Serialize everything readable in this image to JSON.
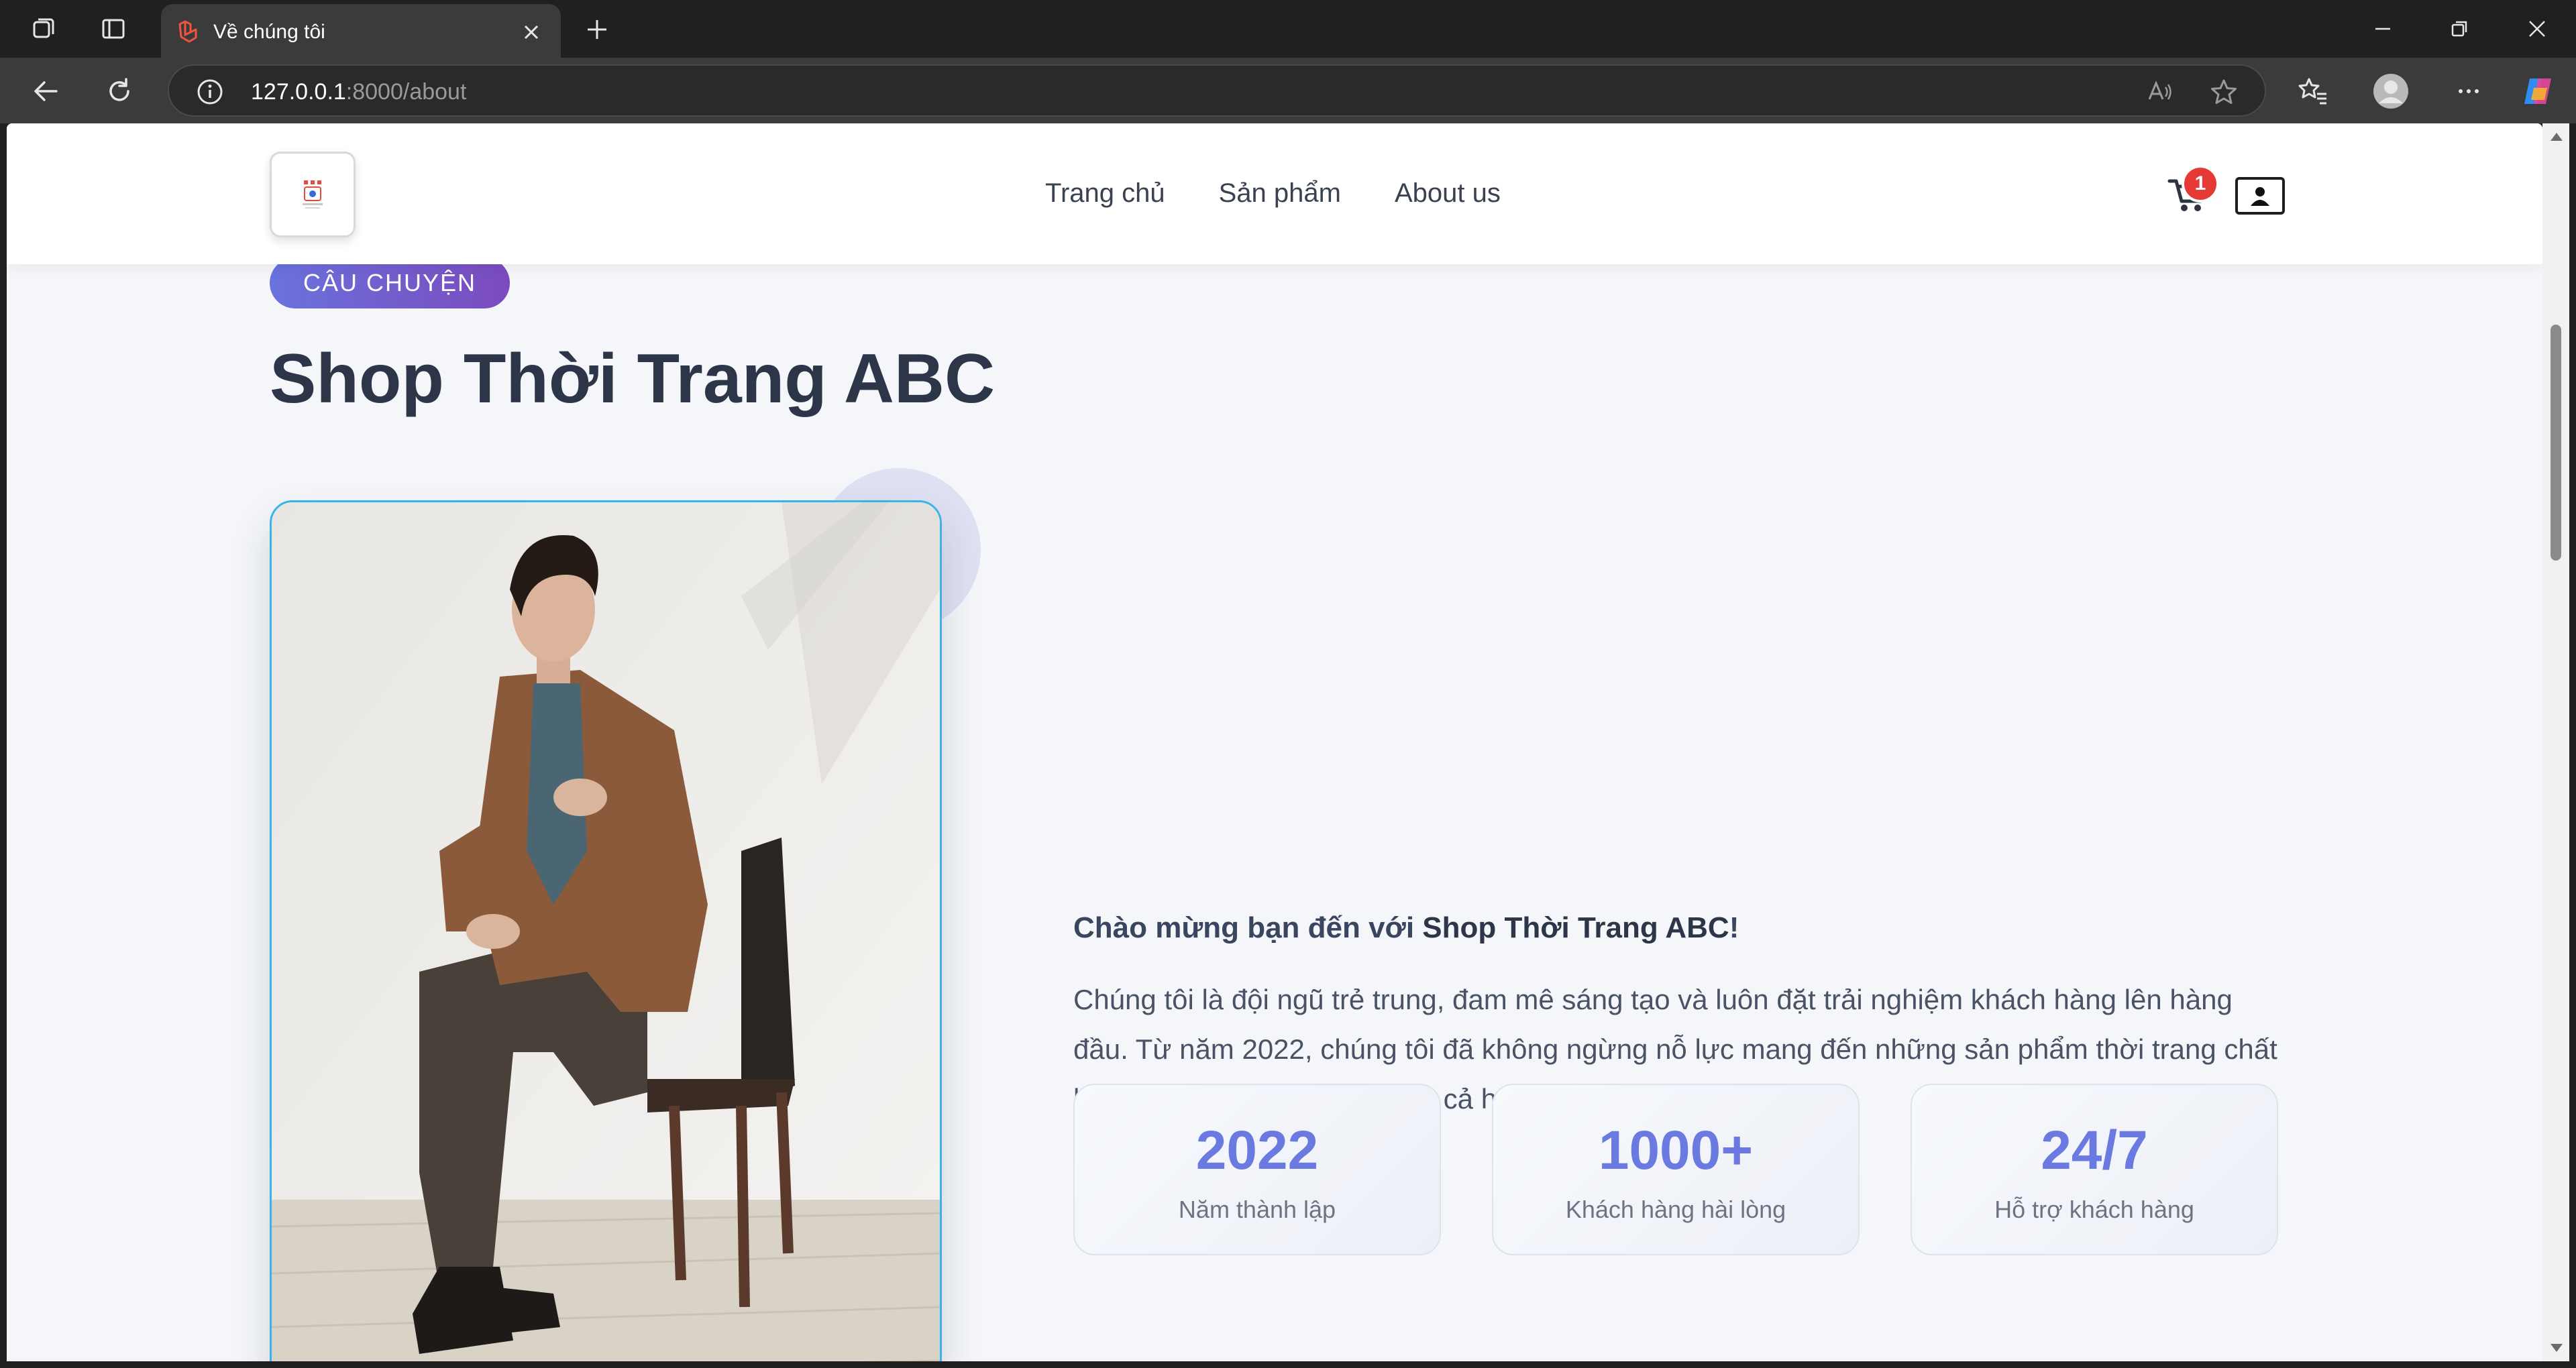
{
  "browser": {
    "tab_title": "Về chúng tôi",
    "url_host": "127.0.0.1",
    "url_rest": ":8000/about"
  },
  "site": {
    "nav": [
      "Trang chủ",
      "Sản phẩm",
      "About us"
    ],
    "cart_count": "1"
  },
  "about": {
    "badge": "CÂU CHUYỆN",
    "title": "Shop Thời Trang ABC",
    "intro_prefix": "Chào mừng bạn đến với ",
    "intro_brand": "Shop Thời Trang ABC",
    "intro_suffix": "!",
    "paragraph": "Chúng tôi là đội ngũ trẻ trung, đam mê sáng tạo và luôn đặt trải nghiệm khách hàng lên hàng đầu. Từ năm 2022, chúng tôi đã không ngừng nỗ lực mang đến những sản phẩm thời trang chất lượng, hợp xu hướng với giá cả hợp lý nhất.",
    "stats": [
      {
        "value": "2022",
        "label": "Năm thành lập"
      },
      {
        "value": "1000+",
        "label": "Khách hàng hài lòng"
      },
      {
        "value": "24/7",
        "label": "Hỗ trợ khách hàng"
      }
    ]
  },
  "colors": {
    "accent": "#6a7ae0",
    "badge_start": "#6a72dd",
    "badge_end": "#7b4bbd",
    "cart_badge": "#e53935",
    "photo_border": "#39b4e8"
  },
  "icons": {
    "browser": [
      "workspaces-icon",
      "tab-actions-icon",
      "laravel-favicon-icon",
      "close-icon",
      "plus-icon",
      "minimize-icon",
      "restore-icon",
      "back-icon",
      "reload-icon",
      "info-icon",
      "read-aloud-icon",
      "star-icon",
      "favorites-icon",
      "profile-icon",
      "more-icon",
      "copilot-icon"
    ],
    "site": [
      "shop-logo-icon",
      "cart-icon",
      "user-icon"
    ]
  }
}
